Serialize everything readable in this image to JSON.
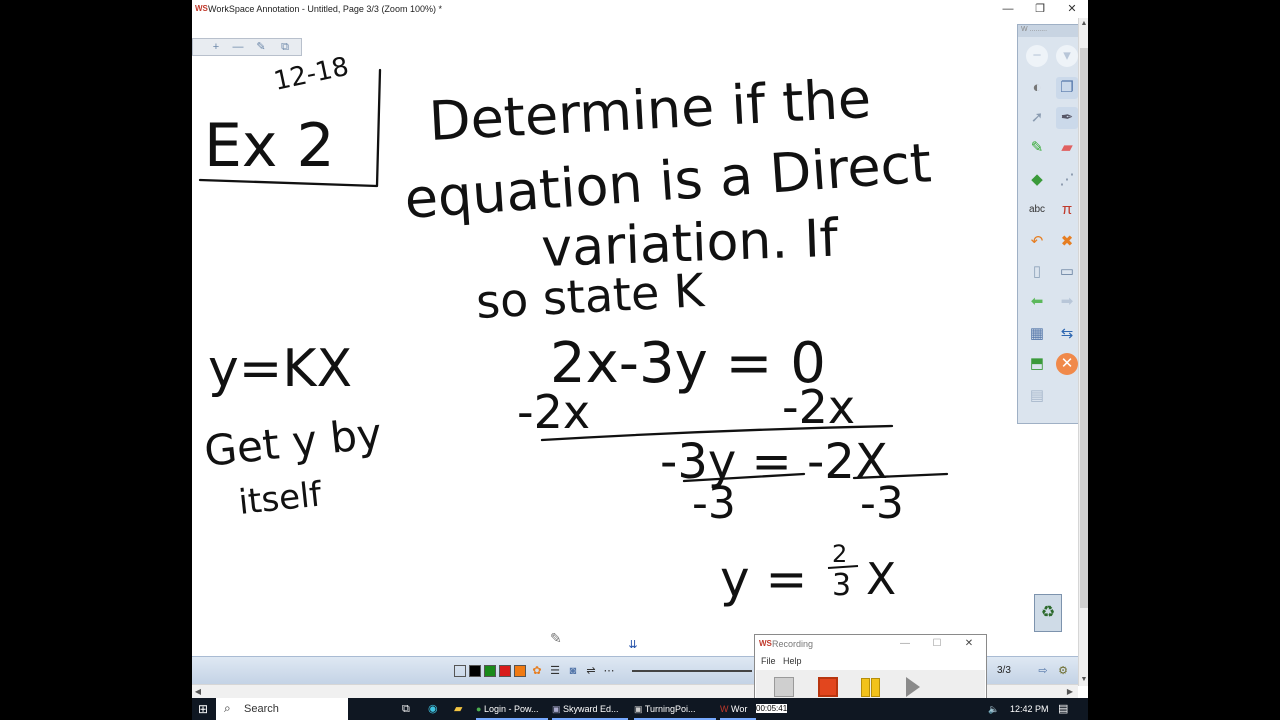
{
  "app": {
    "logo": "WS",
    "title": "WorkSpace Annotation - Untitled, Page 3/3  (Zoom 100%) *",
    "minimize": "—",
    "restore": "❐",
    "close": "✕"
  },
  "mini_toolbar": {
    "icons": [
      "+",
      "—",
      "✎",
      "⧉"
    ]
  },
  "canvas": {
    "lines": [
      "12-18",
      "Ex 2",
      "Determine if the",
      "equation is a Direct",
      "variation. If",
      "so state K",
      "y=KX",
      "Get y by",
      "itself",
      "2x-3y = 0",
      "-2x",
      "-2x",
      "-3y = -2X",
      "-3",
      "-3",
      "y = ",
      "2",
      "3",
      "X"
    ]
  },
  "side_panel": {
    "title": "W .........",
    "icons": [
      "−",
      "+",
      "mouse",
      "pages",
      "pointer",
      "pen",
      "highlighter",
      "eraser",
      "shapes",
      "lines",
      "text",
      "math",
      "undo",
      "delete",
      "page",
      "screen",
      "back",
      "forward",
      "grid",
      "split",
      "capture",
      "exit",
      "doc"
    ]
  },
  "bottom_bar": {
    "colors": [
      "#ffffff",
      "#000000",
      "#1a8a1a",
      "#d81b1b",
      "#f07a13"
    ],
    "page": "3/3",
    "arrow": "⇨",
    "grip": "⇊"
  },
  "recording": {
    "logo": "WS",
    "title": "Recording",
    "menu": [
      "File",
      "Help"
    ],
    "timer": "00:05:41"
  },
  "taskbar": {
    "search": "Search",
    "apps": [
      {
        "label": "Login - Pow..."
      },
      {
        "label": "Skyward Ed..."
      },
      {
        "label": "TurningPoi..."
      },
      {
        "label": "Wor"
      }
    ],
    "time": "12:42 PM"
  }
}
